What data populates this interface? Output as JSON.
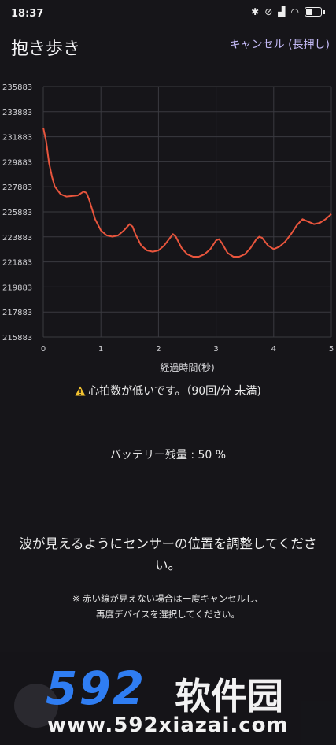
{
  "status": {
    "time": "18:37"
  },
  "header": {
    "title": "抱き歩き",
    "cancel_label": "キャンセル (長押し)"
  },
  "chart_data": {
    "type": "line",
    "xlabel": "経過時間(秒)",
    "ylabel": "",
    "xlim": [
      0,
      5
    ],
    "ylim": [
      215883,
      235883
    ],
    "xticks": [
      0,
      1,
      2,
      3,
      4,
      5
    ],
    "yticks": [
      215883,
      217883,
      219883,
      221883,
      223883,
      225883,
      227883,
      229883,
      231883,
      233883,
      235883
    ],
    "grid": true,
    "color": "#e8553d",
    "x": [
      0,
      0.05,
      0.1,
      0.15,
      0.2,
      0.3,
      0.4,
      0.5,
      0.6,
      0.7,
      0.75,
      0.8,
      0.9,
      1.0,
      1.1,
      1.2,
      1.3,
      1.4,
      1.5,
      1.55,
      1.6,
      1.7,
      1.8,
      1.9,
      2.0,
      2.1,
      2.2,
      2.25,
      2.3,
      2.4,
      2.5,
      2.6,
      2.7,
      2.8,
      2.9,
      3.0,
      3.05,
      3.1,
      3.2,
      3.3,
      3.4,
      3.5,
      3.6,
      3.7,
      3.75,
      3.8,
      3.9,
      4.0,
      4.1,
      4.2,
      4.3,
      4.4,
      4.5,
      4.6,
      4.7,
      4.8,
      4.9,
      5.0
    ],
    "y": [
      232600,
      231500,
      229800,
      228700,
      227900,
      227300,
      227100,
      227150,
      227200,
      227500,
      227400,
      226800,
      225300,
      224400,
      224000,
      223900,
      224000,
      224400,
      224900,
      224700,
      224100,
      223200,
      222800,
      222700,
      222800,
      223200,
      223800,
      224100,
      223900,
      223000,
      222500,
      222300,
      222300,
      222500,
      222900,
      223600,
      223700,
      223400,
      222600,
      222300,
      222300,
      222500,
      223000,
      223700,
      223900,
      223800,
      223200,
      222900,
      223100,
      223500,
      224100,
      224800,
      225300,
      225100,
      224900,
      225000,
      225300,
      225700
    ]
  },
  "warning": {
    "text": "心拍数が低いです。（90回/分 未満)"
  },
  "battery": {
    "text": "バッテリー残量 : 50 %"
  },
  "instruction": {
    "text": "波が見えるようにセンサーの位置を調整してください。"
  },
  "note": {
    "line1": "※ 赤い線が見えない場合は一度キャンセルし、",
    "line2": "再度デバイスを選択してください。"
  },
  "watermark": {
    "brand": "592",
    "brand_cn": "软件园",
    "url": "www.592xiazai.com"
  }
}
